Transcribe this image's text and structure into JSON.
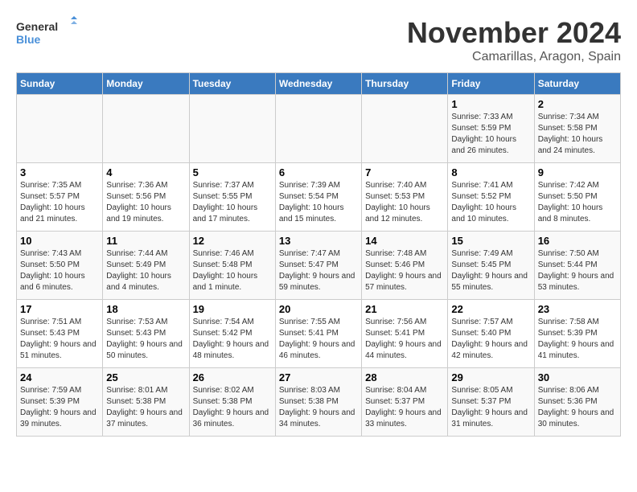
{
  "logo": {
    "line1": "General",
    "line2": "Blue"
  },
  "title": "November 2024",
  "location": "Camarillas, Aragon, Spain",
  "weekdays": [
    "Sunday",
    "Monday",
    "Tuesday",
    "Wednesday",
    "Thursday",
    "Friday",
    "Saturday"
  ],
  "weeks": [
    [
      {
        "day": "",
        "sunrise": "",
        "sunset": "",
        "daylight": ""
      },
      {
        "day": "",
        "sunrise": "",
        "sunset": "",
        "daylight": ""
      },
      {
        "day": "",
        "sunrise": "",
        "sunset": "",
        "daylight": ""
      },
      {
        "day": "",
        "sunrise": "",
        "sunset": "",
        "daylight": ""
      },
      {
        "day": "",
        "sunrise": "",
        "sunset": "",
        "daylight": ""
      },
      {
        "day": "1",
        "sunrise": "Sunrise: 7:33 AM",
        "sunset": "Sunset: 5:59 PM",
        "daylight": "Daylight: 10 hours and 26 minutes."
      },
      {
        "day": "2",
        "sunrise": "Sunrise: 7:34 AM",
        "sunset": "Sunset: 5:58 PM",
        "daylight": "Daylight: 10 hours and 24 minutes."
      }
    ],
    [
      {
        "day": "3",
        "sunrise": "Sunrise: 7:35 AM",
        "sunset": "Sunset: 5:57 PM",
        "daylight": "Daylight: 10 hours and 21 minutes."
      },
      {
        "day": "4",
        "sunrise": "Sunrise: 7:36 AM",
        "sunset": "Sunset: 5:56 PM",
        "daylight": "Daylight: 10 hours and 19 minutes."
      },
      {
        "day": "5",
        "sunrise": "Sunrise: 7:37 AM",
        "sunset": "Sunset: 5:55 PM",
        "daylight": "Daylight: 10 hours and 17 minutes."
      },
      {
        "day": "6",
        "sunrise": "Sunrise: 7:39 AM",
        "sunset": "Sunset: 5:54 PM",
        "daylight": "Daylight: 10 hours and 15 minutes."
      },
      {
        "day": "7",
        "sunrise": "Sunrise: 7:40 AM",
        "sunset": "Sunset: 5:53 PM",
        "daylight": "Daylight: 10 hours and 12 minutes."
      },
      {
        "day": "8",
        "sunrise": "Sunrise: 7:41 AM",
        "sunset": "Sunset: 5:52 PM",
        "daylight": "Daylight: 10 hours and 10 minutes."
      },
      {
        "day": "9",
        "sunrise": "Sunrise: 7:42 AM",
        "sunset": "Sunset: 5:50 PM",
        "daylight": "Daylight: 10 hours and 8 minutes."
      }
    ],
    [
      {
        "day": "10",
        "sunrise": "Sunrise: 7:43 AM",
        "sunset": "Sunset: 5:50 PM",
        "daylight": "Daylight: 10 hours and 6 minutes."
      },
      {
        "day": "11",
        "sunrise": "Sunrise: 7:44 AM",
        "sunset": "Sunset: 5:49 PM",
        "daylight": "Daylight: 10 hours and 4 minutes."
      },
      {
        "day": "12",
        "sunrise": "Sunrise: 7:46 AM",
        "sunset": "Sunset: 5:48 PM",
        "daylight": "Daylight: 10 hours and 1 minute."
      },
      {
        "day": "13",
        "sunrise": "Sunrise: 7:47 AM",
        "sunset": "Sunset: 5:47 PM",
        "daylight": "Daylight: 9 hours and 59 minutes."
      },
      {
        "day": "14",
        "sunrise": "Sunrise: 7:48 AM",
        "sunset": "Sunset: 5:46 PM",
        "daylight": "Daylight: 9 hours and 57 minutes."
      },
      {
        "day": "15",
        "sunrise": "Sunrise: 7:49 AM",
        "sunset": "Sunset: 5:45 PM",
        "daylight": "Daylight: 9 hours and 55 minutes."
      },
      {
        "day": "16",
        "sunrise": "Sunrise: 7:50 AM",
        "sunset": "Sunset: 5:44 PM",
        "daylight": "Daylight: 9 hours and 53 minutes."
      }
    ],
    [
      {
        "day": "17",
        "sunrise": "Sunrise: 7:51 AM",
        "sunset": "Sunset: 5:43 PM",
        "daylight": "Daylight: 9 hours and 51 minutes."
      },
      {
        "day": "18",
        "sunrise": "Sunrise: 7:53 AM",
        "sunset": "Sunset: 5:43 PM",
        "daylight": "Daylight: 9 hours and 50 minutes."
      },
      {
        "day": "19",
        "sunrise": "Sunrise: 7:54 AM",
        "sunset": "Sunset: 5:42 PM",
        "daylight": "Daylight: 9 hours and 48 minutes."
      },
      {
        "day": "20",
        "sunrise": "Sunrise: 7:55 AM",
        "sunset": "Sunset: 5:41 PM",
        "daylight": "Daylight: 9 hours and 46 minutes."
      },
      {
        "day": "21",
        "sunrise": "Sunrise: 7:56 AM",
        "sunset": "Sunset: 5:41 PM",
        "daylight": "Daylight: 9 hours and 44 minutes."
      },
      {
        "day": "22",
        "sunrise": "Sunrise: 7:57 AM",
        "sunset": "Sunset: 5:40 PM",
        "daylight": "Daylight: 9 hours and 42 minutes."
      },
      {
        "day": "23",
        "sunrise": "Sunrise: 7:58 AM",
        "sunset": "Sunset: 5:39 PM",
        "daylight": "Daylight: 9 hours and 41 minutes."
      }
    ],
    [
      {
        "day": "24",
        "sunrise": "Sunrise: 7:59 AM",
        "sunset": "Sunset: 5:39 PM",
        "daylight": "Daylight: 9 hours and 39 minutes."
      },
      {
        "day": "25",
        "sunrise": "Sunrise: 8:01 AM",
        "sunset": "Sunset: 5:38 PM",
        "daylight": "Daylight: 9 hours and 37 minutes."
      },
      {
        "day": "26",
        "sunrise": "Sunrise: 8:02 AM",
        "sunset": "Sunset: 5:38 PM",
        "daylight": "Daylight: 9 hours and 36 minutes."
      },
      {
        "day": "27",
        "sunrise": "Sunrise: 8:03 AM",
        "sunset": "Sunset: 5:38 PM",
        "daylight": "Daylight: 9 hours and 34 minutes."
      },
      {
        "day": "28",
        "sunrise": "Sunrise: 8:04 AM",
        "sunset": "Sunset: 5:37 PM",
        "daylight": "Daylight: 9 hours and 33 minutes."
      },
      {
        "day": "29",
        "sunrise": "Sunrise: 8:05 AM",
        "sunset": "Sunset: 5:37 PM",
        "daylight": "Daylight: 9 hours and 31 minutes."
      },
      {
        "day": "30",
        "sunrise": "Sunrise: 8:06 AM",
        "sunset": "Sunset: 5:36 PM",
        "daylight": "Daylight: 9 hours and 30 minutes."
      }
    ]
  ]
}
